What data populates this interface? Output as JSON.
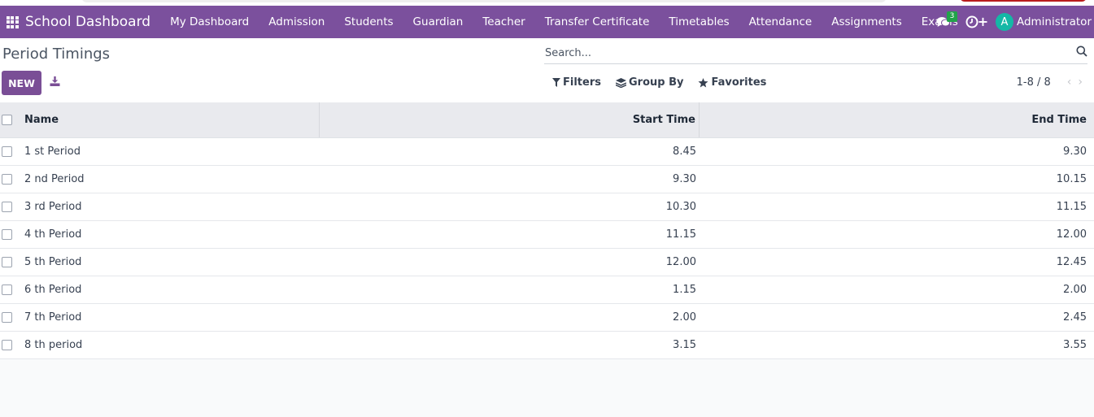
{
  "navbar": {
    "brand": "School Dashboard",
    "menu": [
      "My Dashboard",
      "Admission",
      "Students",
      "Guardian",
      "Teacher",
      "Transfer Certificate",
      "Timetables",
      "Attendance",
      "Assignments",
      "Exams"
    ],
    "plus": "+",
    "chat_badge": "3",
    "avatar_letter": "A",
    "user": "Administrator"
  },
  "page": {
    "title": "Period Timings",
    "new_label": "NEW",
    "search_placeholder": "Search...",
    "filters_label": "Filters",
    "groupby_label": "Group By",
    "favorites_label": "Favorites",
    "pager": "1-8 / 8",
    "prev": "‹",
    "next": "›"
  },
  "table": {
    "headers": {
      "name": "Name",
      "start": "Start Time",
      "end": "End Time"
    },
    "rows": [
      {
        "name": "1 st Period",
        "start": "8.45",
        "end": "9.30"
      },
      {
        "name": "2 nd Period",
        "start": "9.30",
        "end": "10.15"
      },
      {
        "name": "3 rd Period",
        "start": "10.30",
        "end": "11.15"
      },
      {
        "name": "4 th Period",
        "start": "11.15",
        "end": "12.00"
      },
      {
        "name": "5 th Period",
        "start": "12.00",
        "end": "12.45"
      },
      {
        "name": "6 th Period",
        "start": "1.15",
        "end": "2.00"
      },
      {
        "name": "7 th Period",
        "start": "2.00",
        "end": "2.45"
      },
      {
        "name": "8 th period",
        "start": "3.15",
        "end": "3.55"
      }
    ]
  },
  "colors": {
    "navbar": "#7b509d",
    "primary_button": "#7a4e96",
    "badge": "#22a34a",
    "avatar": "#14b8a6"
  },
  "icons": {
    "apps": "apps-grid-icon",
    "chat": "chat-bubbles-icon",
    "clock": "clock-icon",
    "download": "download-icon",
    "search": "search-icon",
    "filter": "filter-icon",
    "groupby": "layers-icon",
    "favorites": "star-icon"
  }
}
